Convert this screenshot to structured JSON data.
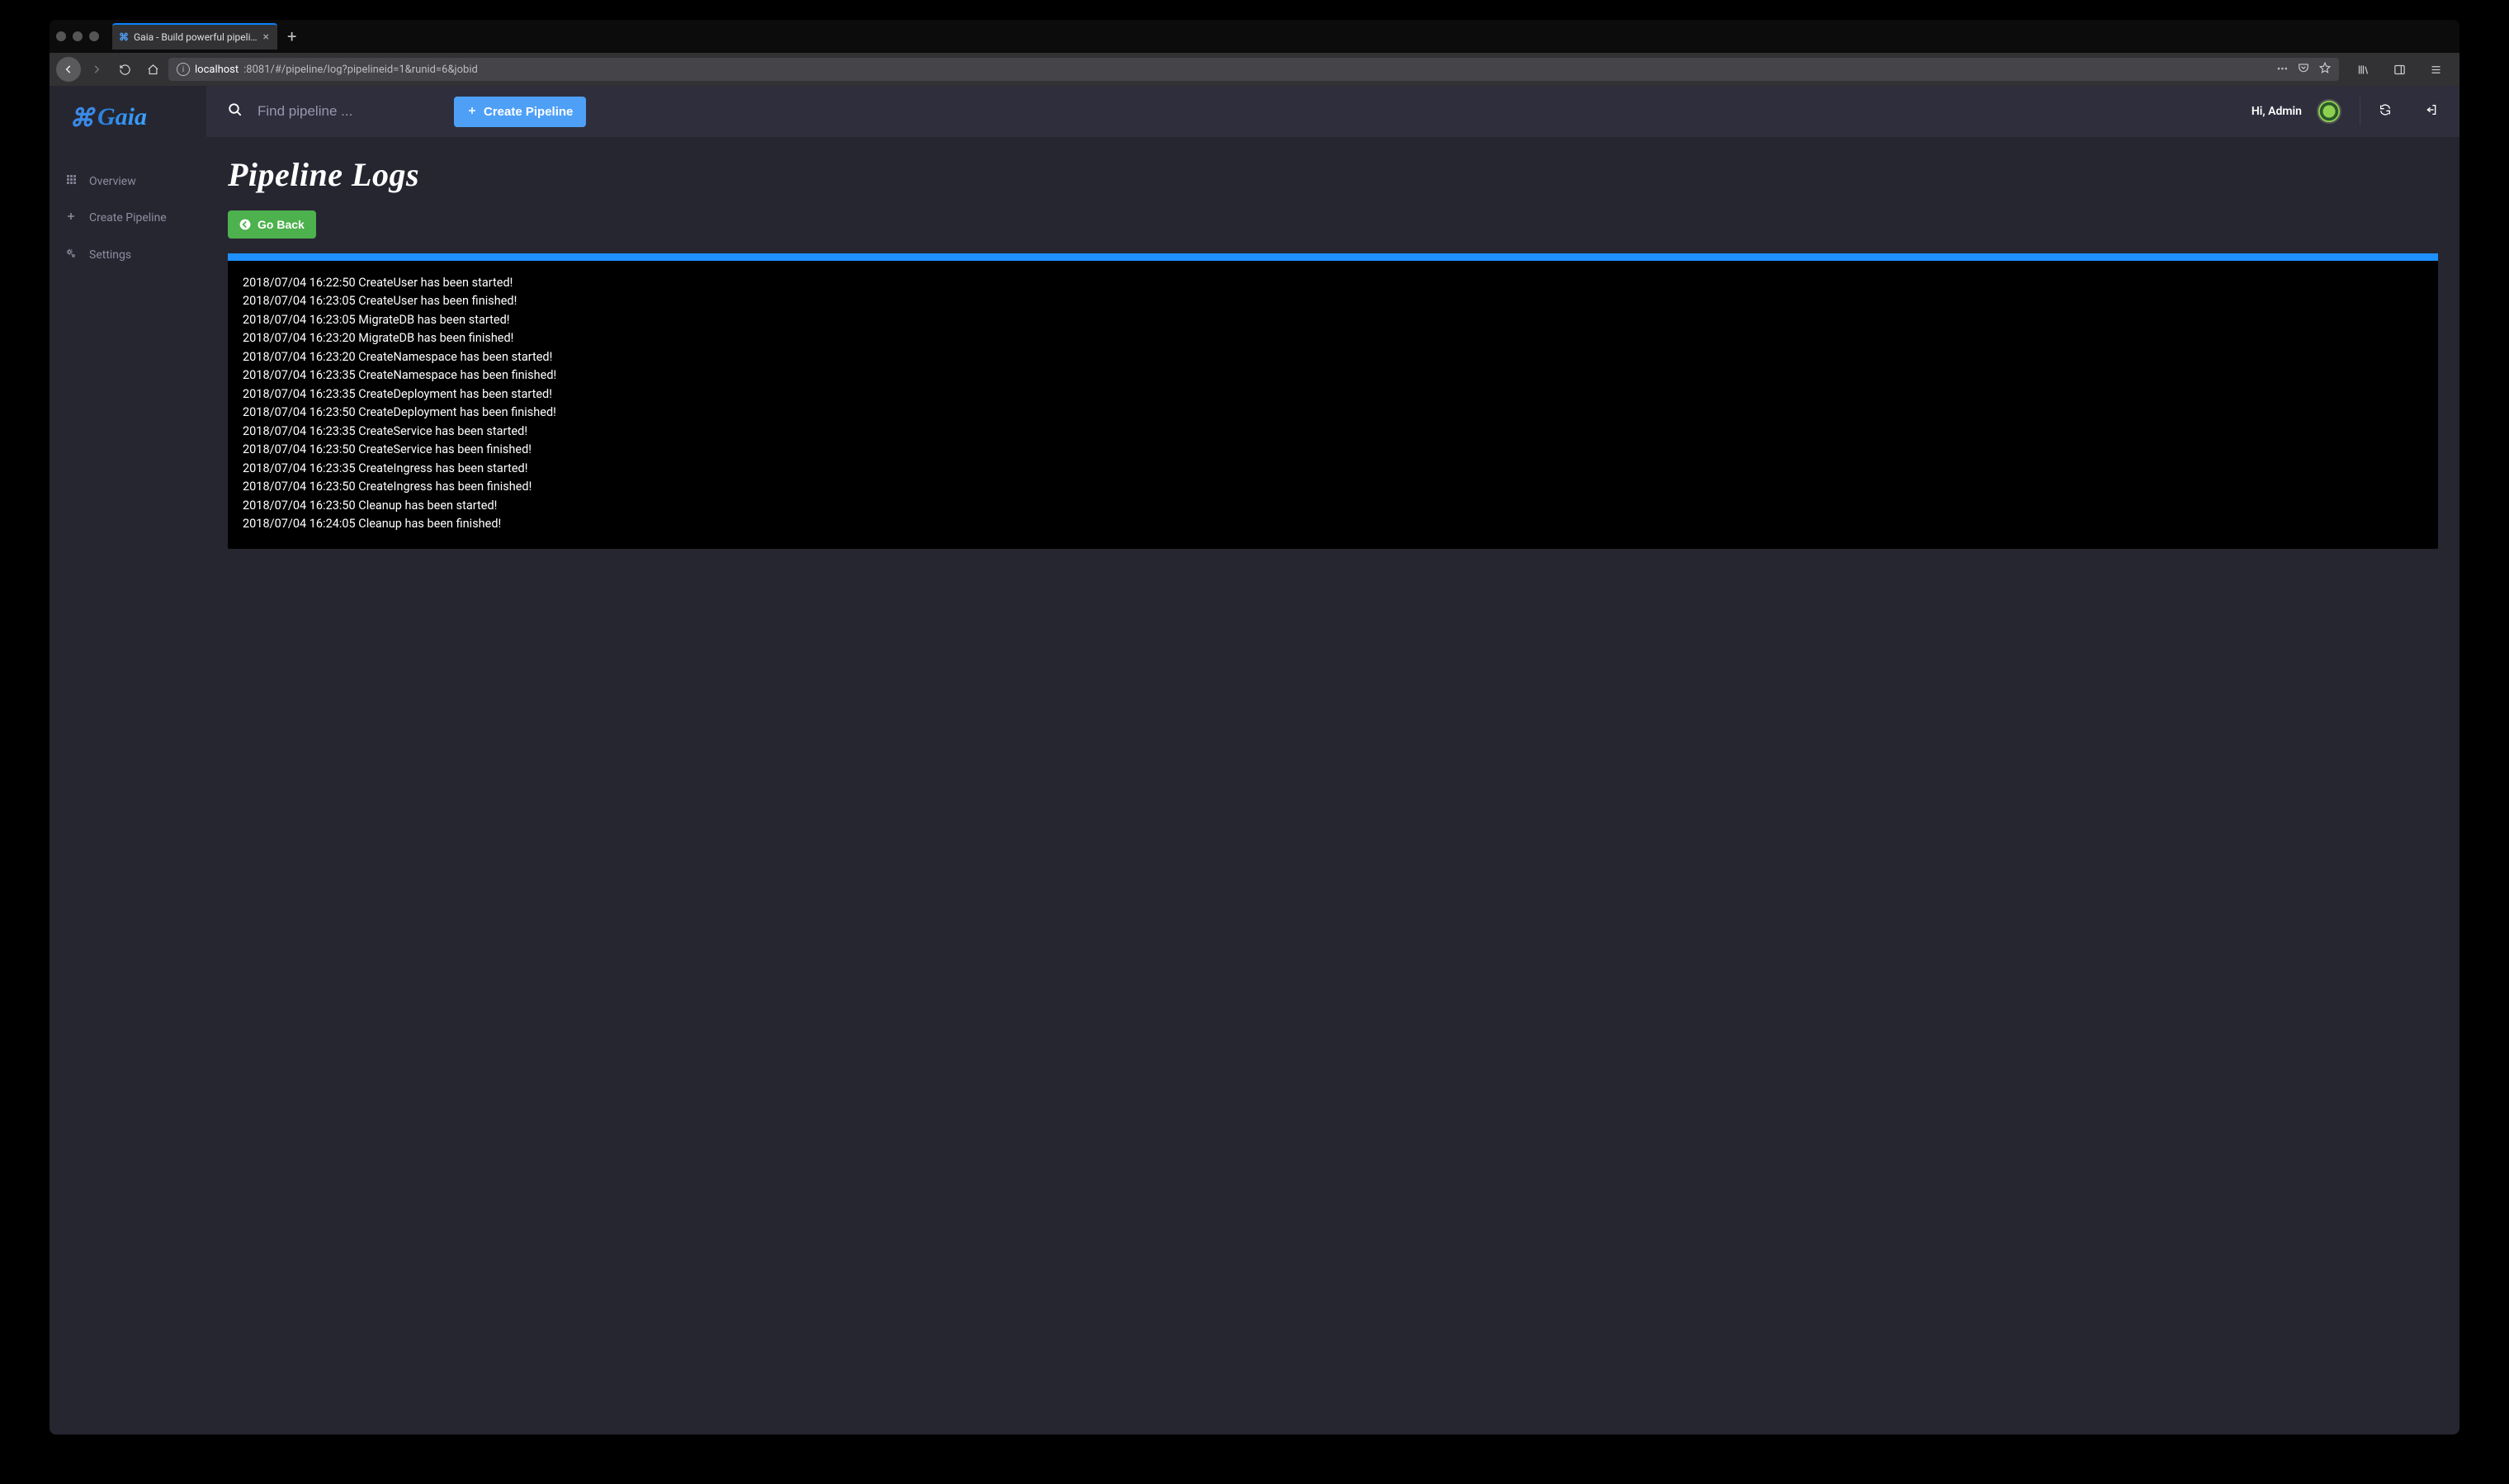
{
  "browser": {
    "tab_title": "Gaia - Build powerful pipelines",
    "url_host": "localhost",
    "url_rest": ":8081/#/pipeline/log?pipelineid=1&runid=6&jobid"
  },
  "brand": "Gaia",
  "sidebar": {
    "items": [
      {
        "label": "Overview",
        "icon": "grid-icon"
      },
      {
        "label": "Create Pipeline",
        "icon": "plus-icon"
      },
      {
        "label": "Settings",
        "icon": "gears-icon"
      }
    ]
  },
  "topbar": {
    "search_placeholder": "Find pipeline ...",
    "create_label": "Create Pipeline",
    "greeting": "Hi, Admin"
  },
  "page": {
    "title": "Pipeline Logs",
    "goback_label": "Go Back"
  },
  "logs": [
    "2018/07/04 16:22:50 CreateUser has been started!",
    "2018/07/04 16:23:05 CreateUser has been finished!",
    "2018/07/04 16:23:05 MigrateDB has been started!",
    "2018/07/04 16:23:20 MigrateDB has been finished!",
    "2018/07/04 16:23:20 CreateNamespace has been started!",
    "2018/07/04 16:23:35 CreateNamespace has been finished!",
    "2018/07/04 16:23:35 CreateDeployment has been started!",
    "2018/07/04 16:23:50 CreateDeployment has been finished!",
    "2018/07/04 16:23:35 CreateService has been started!",
    "2018/07/04 16:23:50 CreateService has been finished!",
    "2018/07/04 16:23:35 CreateIngress has been started!",
    "2018/07/04 16:23:50 CreateIngress has been finished!",
    "2018/07/04 16:23:50 Cleanup has been started!",
    "2018/07/04 16:24:05 Cleanup has been finished!"
  ]
}
